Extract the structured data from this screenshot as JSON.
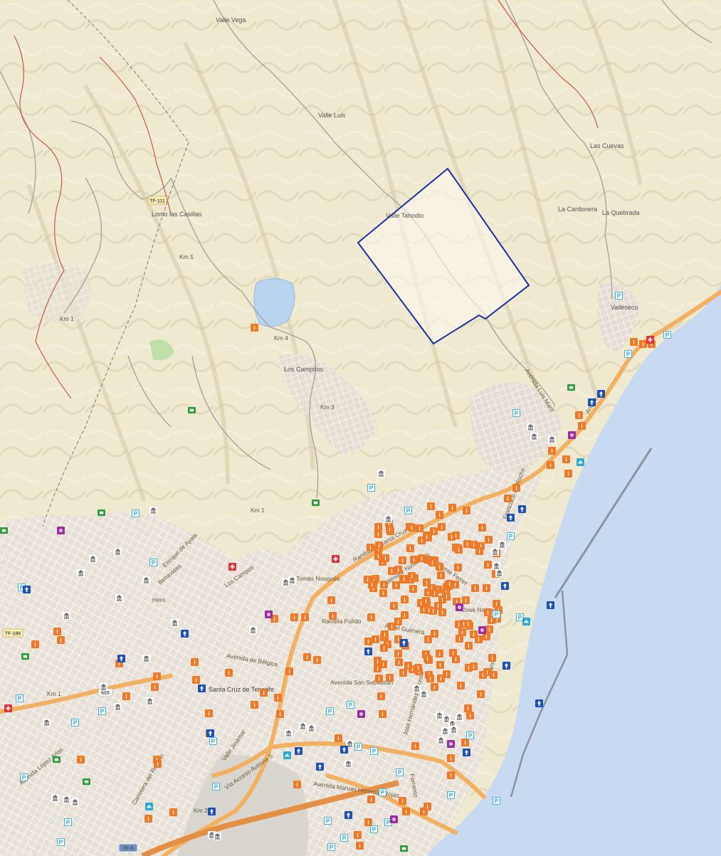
{
  "map": {
    "place_labels": [
      {
        "id": "valle-vega",
        "text": "Valle Vega"
      },
      {
        "id": "valle-luis",
        "text": "Valle Luis"
      },
      {
        "id": "las-cuevas",
        "text": "Las Cuevas"
      },
      {
        "id": "la-cardonera",
        "text": "La Cardonera"
      },
      {
        "id": "la-quebrada",
        "text": "La Quebrada"
      },
      {
        "id": "valle-tahodio",
        "text": "Valle Tahodio"
      },
      {
        "id": "lomo-las-casillas",
        "text": "Lomo las Casillas"
      },
      {
        "id": "valleseco",
        "text": "Valleseco"
      },
      {
        "id": "los-campitos",
        "text": "Los Campitos"
      },
      {
        "id": "santa-cruz",
        "text": "Santa Cruz de Tenerife"
      }
    ],
    "road_labels": [
      {
        "id": "km5",
        "text": "Km 5"
      },
      {
        "id": "km4",
        "text": "Km 4"
      },
      {
        "id": "km3",
        "text": "Km 3"
      },
      {
        "id": "km1a",
        "text": "Km 1"
      },
      {
        "id": "km1b",
        "text": "Km 1"
      },
      {
        "id": "km1c",
        "text": "Km 1"
      },
      {
        "id": "km2",
        "text": "Km 2"
      },
      {
        "id": "av-luis-marti",
        "text": "Avenida Luis Martí"
      },
      {
        "id": "rambla-sc",
        "text": "Rambla de Santa Cruz"
      },
      {
        "id": "rambla-pulido",
        "text": "Rambla Pulido"
      },
      {
        "id": "av-belgica",
        "text": "Avenida de Bélgica"
      },
      {
        "id": "av-san-sebastian",
        "text": "Avenida San Sebastián"
      },
      {
        "id": "av-manuel-hermoso",
        "text": "Avenida Manuel Hermoso Rojas"
      },
      {
        "id": "via-acceso",
        "text": "Vía Acceso Autovía 5"
      },
      {
        "id": "carretera-rosario",
        "text": "Carretera del Rosario"
      },
      {
        "id": "av-lopez-arias",
        "text": "Avenida López Arias"
      },
      {
        "id": "valle-jinamar",
        "text": "Valle Jinámar"
      },
      {
        "id": "fomento",
        "text": "Fomento"
      },
      {
        "id": "jose-hernandez",
        "text": "José Hernández Alfonso"
      },
      {
        "id": "anaga",
        "text": "Anaga"
      },
      {
        "id": "francisco-la-roche",
        "text": "Francisco La Roche"
      },
      {
        "id": "enrique-de-ayala",
        "text": "Enrique de Ayala"
      },
      {
        "id": "benavides",
        "text": "Benavides"
      },
      {
        "id": "hero",
        "text": "Hero"
      },
      {
        "id": "los-campos",
        "text": "Los Campos"
      },
      {
        "id": "tomas-nougues",
        "text": "Tomás Nougués"
      },
      {
        "id": "san-vicente",
        "text": "San Vicente Ferrer"
      },
      {
        "id": "mendez-nunez",
        "text": "Méndez Núñez"
      },
      {
        "id": "angel-guimera",
        "text": "Ángel Guimerá"
      },
      {
        "id": "marina",
        "text": "Marina"
      },
      {
        "id": "jose-ramon",
        "text": "José Naveiras"
      }
    ],
    "shields": [
      {
        "id": "tf111",
        "text": "TF-111"
      },
      {
        "id": "tf186",
        "text": "TF-186"
      },
      {
        "id": "tf5",
        "text": "TF-5"
      },
      {
        "id": "r605",
        "text": "605"
      }
    ],
    "selection_polygon_color": "#1a2fa8",
    "colors": {
      "terrain": "#efe9cf",
      "sea": "#c8d9f2",
      "urban": "#e3ddd2",
      "main_road": "#f3b060",
      "poi_orange": "#ee7a28",
      "poi_blue": "#1e4fb3",
      "poi_cyan": "#2aa9d6",
      "poi_green": "#2a9a3a",
      "poi_purple": "#9a2fa0",
      "poi_red": "#d9303a"
    },
    "icons": [
      "tourism-icon",
      "museum-icon",
      "parking-icon",
      "hospital-icon",
      "police-icon",
      "viewpoint-icon",
      "bus-stop-icon",
      "pharmacy-icon",
      "info-icon",
      "port-icon"
    ]
  }
}
